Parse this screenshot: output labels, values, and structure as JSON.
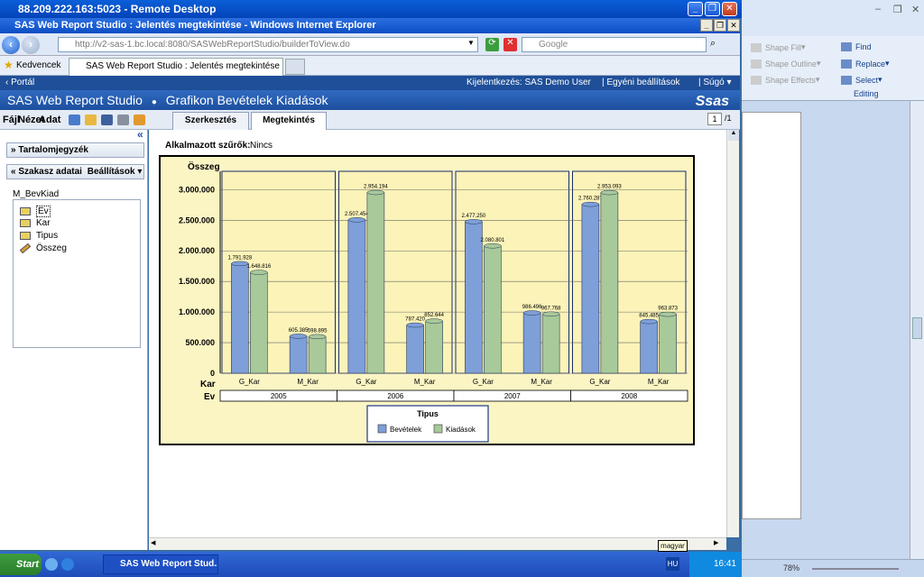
{
  "remote": {
    "title": "88.209.222.163:5023 - Remote Desktop"
  },
  "ie": {
    "title": "SAS Web Report Studio : Jelentés megtekintése - Windows Internet Explorer",
    "url": "http://v2-sas-1.bc.local:8080/SASWebReportStudio/builderToView.do",
    "search_placeholder": "Google",
    "favorites_label": "Kedvencek",
    "tab_label": "SAS Web Report Studio : Jelentés megtekintése"
  },
  "sas": {
    "portal": "Portál",
    "logout": "Kijelentkezés: SAS Demo User",
    "settings": "Egyéni beállítások",
    "help": "Súgó",
    "app_title": "SAS Web Report Studio",
    "report_title": "Grafikon Bevételek Kiadások",
    "logo": "sas",
    "menu": {
      "file": "Fájl",
      "view": "Nézet",
      "data": "Adat"
    },
    "tabs": [
      "Szerkesztés",
      "Megtekintés"
    ],
    "page": {
      "current": "1",
      "total": "/1"
    }
  },
  "left": {
    "toc": "Tartalomjegyzék",
    "section": "Szakasz adatai",
    "settings": "Beállítások",
    "dataset": "M_BevKiad",
    "items": [
      "Ev",
      "Kar",
      "Tipus",
      "Összeg"
    ]
  },
  "filters": {
    "label": "Alkalmazott szűrők:",
    "value": "Nincs"
  },
  "chart_data": {
    "type": "bar",
    "ylabel": "Összeg",
    "xlabel_inner": "Kar",
    "xlabel_outer": "Ev",
    "ylim": [
      0,
      3300000
    ],
    "yticks": [
      "0",
      "500.000",
      "1.000.000",
      "1.500.000",
      "2.000.000",
      "2.500.000",
      "3.000.000"
    ],
    "ytick_values": [
      0,
      500000,
      1000000,
      1500000,
      2000000,
      2500000,
      3000000
    ],
    "groups": [
      "2005",
      "2006",
      "2007",
      "2008"
    ],
    "categories": [
      "G_Kar",
      "M_Kar"
    ],
    "legend_title": "Tipus",
    "series": [
      {
        "name": "Bevételek",
        "color": "#7e9fd8",
        "values": [
          1791928,
          605385,
          2507454,
          787420,
          2477250,
          986496,
          2760287,
          845485
        ],
        "labels": [
          "1.791.928",
          "605.385",
          "2.507.454",
          "787.420",
          "2.477.250",
          "986.496",
          "2.760.287",
          "845.485"
        ]
      },
      {
        "name": "Kiadások",
        "color": "#a8c99a",
        "values": [
          1648816,
          598895,
          2954194,
          852644,
          2080801,
          967768,
          2953093,
          963873
        ],
        "labels": [
          "1.648.816",
          "598.895",
          "2.954.194",
          "852.644",
          "2.080.801",
          "967.768",
          "2.953.093",
          "963.873"
        ]
      }
    ]
  },
  "taskbar": {
    "start": "Start",
    "task": "SAS Web Report Stud...",
    "lang_badge": "magyar",
    "lang": "HU",
    "time": "16:41"
  },
  "word": {
    "shape_fill": "Shape Fill",
    "shape_outline": "Shape Outline",
    "shape_effects": "Shape Effects",
    "find": "Find",
    "replace": "Replace",
    "select": "Select",
    "editing": "Editing",
    "zoom": "78%"
  }
}
